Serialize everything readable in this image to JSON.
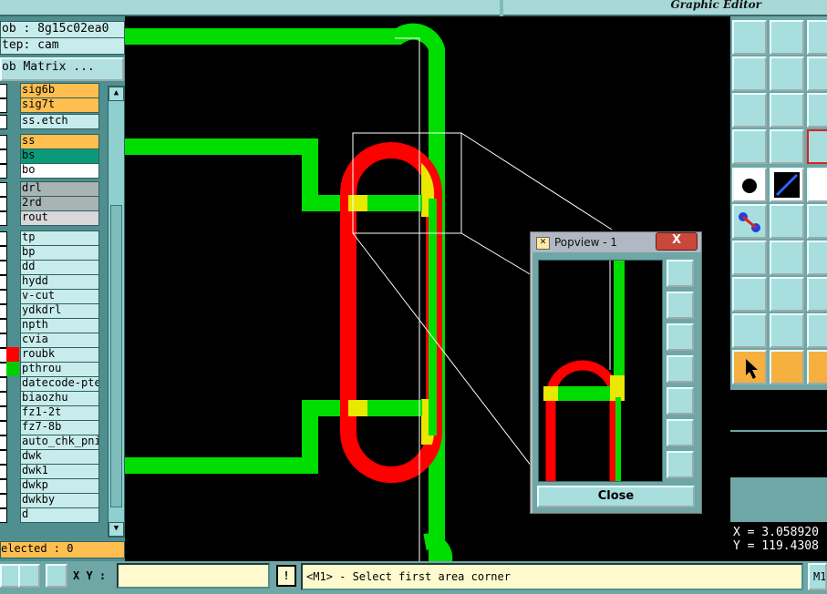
{
  "header": {
    "editor_label": "Graphic Editor"
  },
  "left_panel": {
    "job": "ob : 8g15c02ea0",
    "step": "tep: cam",
    "matrix_button": "ob Matrix ...",
    "layers": [
      {
        "name": "sig6b",
        "color": "#ffbe50"
      },
      {
        "name": "sig7t",
        "color": "#ffbe50"
      },
      {
        "name": "ss.etch",
        "color": "#c8ecec"
      },
      {
        "name": "ss",
        "color": "#ffbe50"
      },
      {
        "name": "bs",
        "color": "#0a9a7a"
      },
      {
        "name": "bo",
        "color": "#ffffff"
      },
      {
        "name": "drl",
        "color": "#a8b4b4"
      },
      {
        "name": "2rd",
        "color": "#a8b4b4"
      },
      {
        "name": "rout",
        "color": "#d8d8d8"
      },
      {
        "name": "tp",
        "color": "#c8ecec"
      },
      {
        "name": "bp",
        "color": "#c8ecec"
      },
      {
        "name": "dd",
        "color": "#c8ecec"
      },
      {
        "name": "hydd",
        "color": "#c8ecec"
      },
      {
        "name": "v-cut",
        "color": "#c8ecec"
      },
      {
        "name": "ydkdrl",
        "color": "#c8ecec"
      },
      {
        "name": "npth",
        "color": "#c8ecec"
      },
      {
        "name": "cvia",
        "color": "#c8ecec"
      },
      {
        "name": "roubk",
        "color": "#c8ecec",
        "swatch": "#ff0000"
      },
      {
        "name": "pthrou",
        "color": "#c8ecec",
        "swatch": "#00cc00"
      },
      {
        "name": "datecode-pte",
        "color": "#c8ecec"
      },
      {
        "name": "biaozhu",
        "color": "#c8ecec"
      },
      {
        "name": "fz1-2t",
        "color": "#c8ecec"
      },
      {
        "name": "fz7-8b",
        "color": "#c8ecec"
      },
      {
        "name": "auto_chk_pni",
        "color": "#c8ecec"
      },
      {
        "name": "dwk",
        "color": "#c8ecec"
      },
      {
        "name": "dwk1",
        "color": "#c8ecec"
      },
      {
        "name": "dwkp",
        "color": "#c8ecec"
      },
      {
        "name": "dwkby",
        "color": "#c8ecec"
      },
      {
        "name": "d",
        "color": "#c8ecec"
      }
    ],
    "selected": "elected : 0"
  },
  "popview": {
    "title": "Popview - 1",
    "close_x": "X",
    "close_button": "Close"
  },
  "right_panel": {
    "coord_x": "X = 3.058920",
    "coord_y": "Y = 119.4308"
  },
  "bottom_bar": {
    "xy_label": "X Y :",
    "xy_value": "",
    "excl": "!",
    "status": "<M1> - Select first area corner",
    "m_button": "M1"
  },
  "colors": {
    "trace_green": "#00dd00",
    "rout_red": "#ff0000",
    "overlap": "#e8e800"
  }
}
